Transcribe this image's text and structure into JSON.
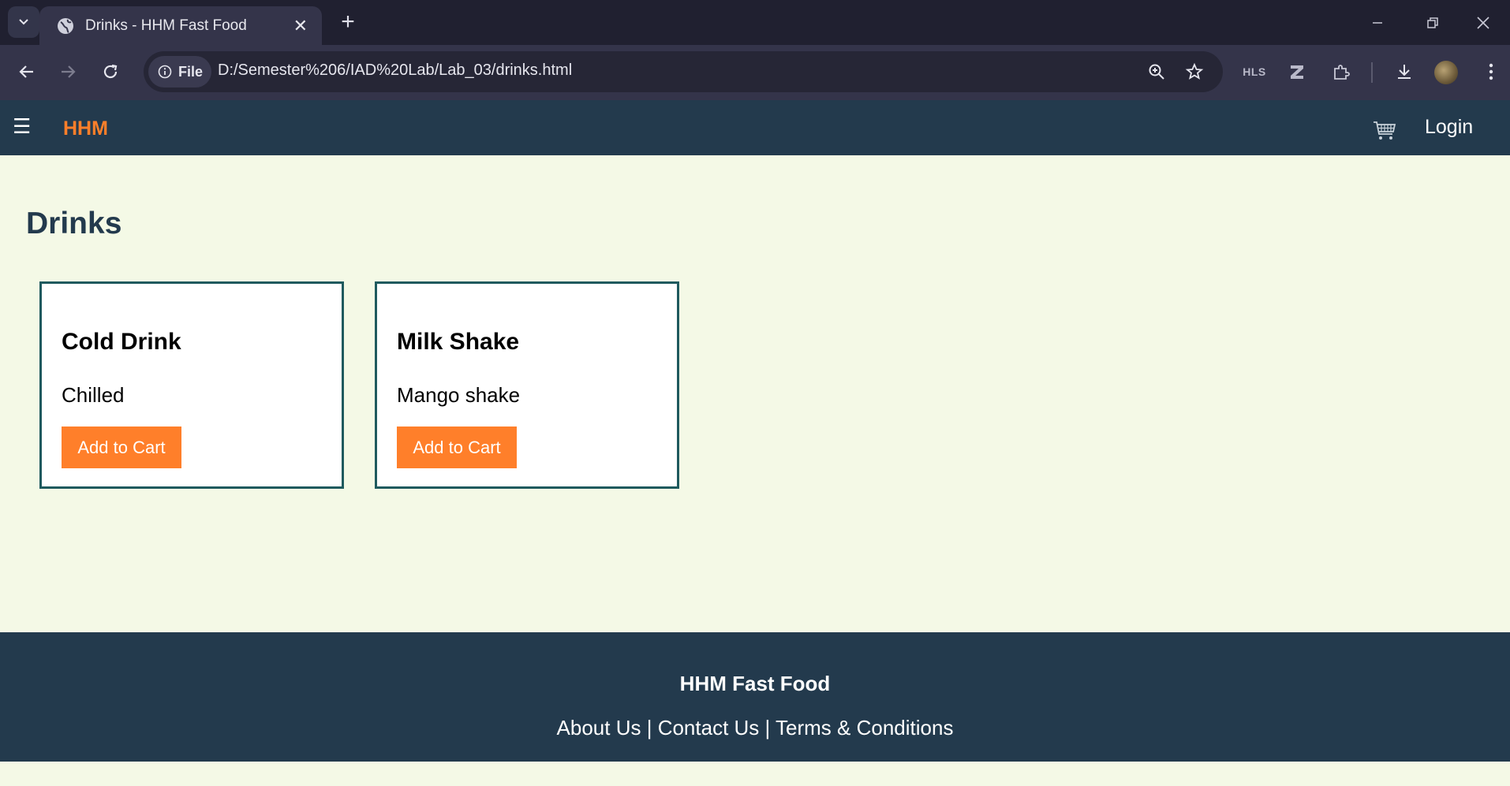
{
  "browser": {
    "tab_title": "Drinks - HHM Fast Food",
    "url_chip": "File",
    "url": "D:/Semester%206/IAD%20Lab/Lab_03/drinks.html",
    "extension_hls": "HLS"
  },
  "header": {
    "menu_glyph": "☰",
    "brand": "HHM",
    "login": "Login"
  },
  "page": {
    "title": "Drinks",
    "cards": [
      {
        "name": "Cold Drink",
        "description": "Chilled",
        "button": "Add to Cart"
      },
      {
        "name": "Milk Shake",
        "description": "Mango shake",
        "button": "Add to Cart"
      }
    ]
  },
  "footer": {
    "title": "HHM Fast Food",
    "links": [
      "About Us",
      "Contact Us",
      "Terms & Conditions"
    ],
    "separator": " | "
  },
  "colors": {
    "accent": "#ff7f2a",
    "header_bg": "#233a4d",
    "page_bg": "#f4f9e6",
    "card_border": "#1f5a5e"
  }
}
